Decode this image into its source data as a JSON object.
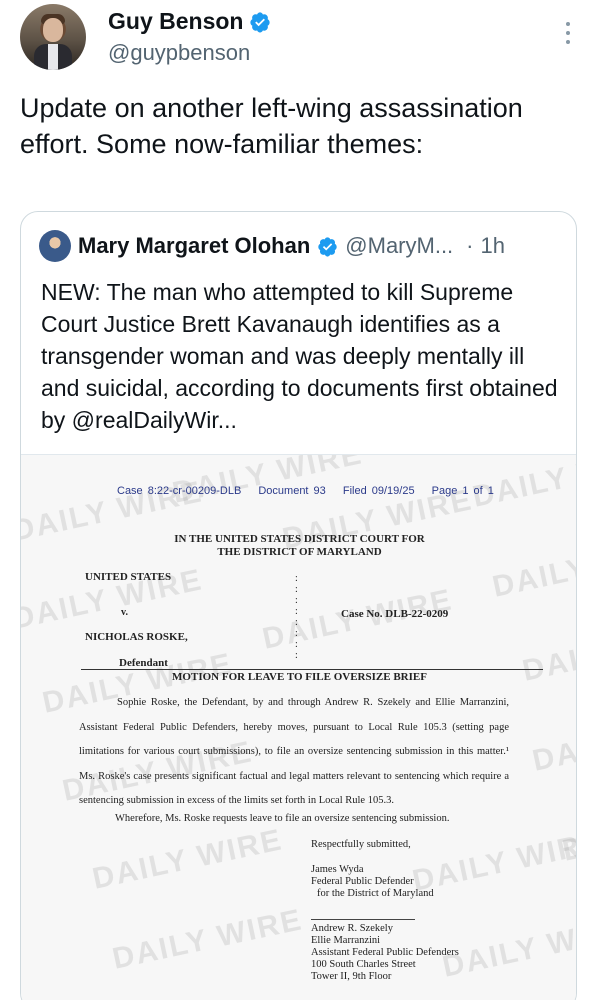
{
  "author": {
    "display_name": "Guy Benson",
    "handle": "@guypbenson",
    "avatar_icon": "profile-photo",
    "verified_color": "#1d9bf0"
  },
  "tweet": {
    "text": "Update on another left-wing assassination effort. Some now-familiar themes:"
  },
  "quoted_tweet": {
    "display_name": "Mary Margaret Olohan",
    "handle": "@MaryM...",
    "time": "1h",
    "text": "NEW: The man who attempted to kill Supreme Court Justice Brett Kavanaugh identifies as a transgender woman and was deeply mentally ill and suicidal, according to documents first obtained by @realDailyWir..."
  },
  "document": {
    "watermark": "DAILY WIRE",
    "case": "Case 8:22-cr-00209-DLB",
    "document_no": "Document 93",
    "filed": "Filed 09/19/25",
    "page": "Page 1 of 1",
    "court_line1": "IN THE UNITED STATES DISTRICT COURT FOR",
    "court_line2": "THE DISTRICT OF MARYLAND",
    "plaintiff": "UNITED STATES",
    "versus": "v.",
    "case_no": "Case No.  DLB-22-0209",
    "defendant_name": "NICHOLAS ROSKE,",
    "defendant_label": "Defendant",
    "motion_title": "MOTION FOR LEAVE TO FILE OVERSIZE BRIEF",
    "paragraph": "Sophie Roske, the Defendant, by and through Andrew R. Szekely and Ellie Marranzini, Assistant Federal Public Defenders, hereby moves, pursuant to Local Rule 105.3 (setting page limitations for various court submissions), to file an oversize sentencing submission in this matter.¹ Ms. Roske's case presents significant factual and legal matters relevant to sentencing which require a sentencing submission in excess of the limits set forth in Local Rule 105.3.",
    "wherefore": "Wherefore, Ms. Roske requests leave to file an oversize sentencing submission.",
    "closing": "Respectfully submitted,",
    "sig1_name": "James Wyda",
    "sig1_title": "Federal Public Defender",
    "sig1_district": "for the District of Maryland",
    "sig2_name": "Andrew R. Szekely",
    "sig2_name2": "Ellie Marranzini",
    "sig2_title": "Assistant Federal Public Defenders",
    "sig2_address": "100 South Charles Street",
    "sig2_address2": "Tower II, 9th Floor"
  }
}
